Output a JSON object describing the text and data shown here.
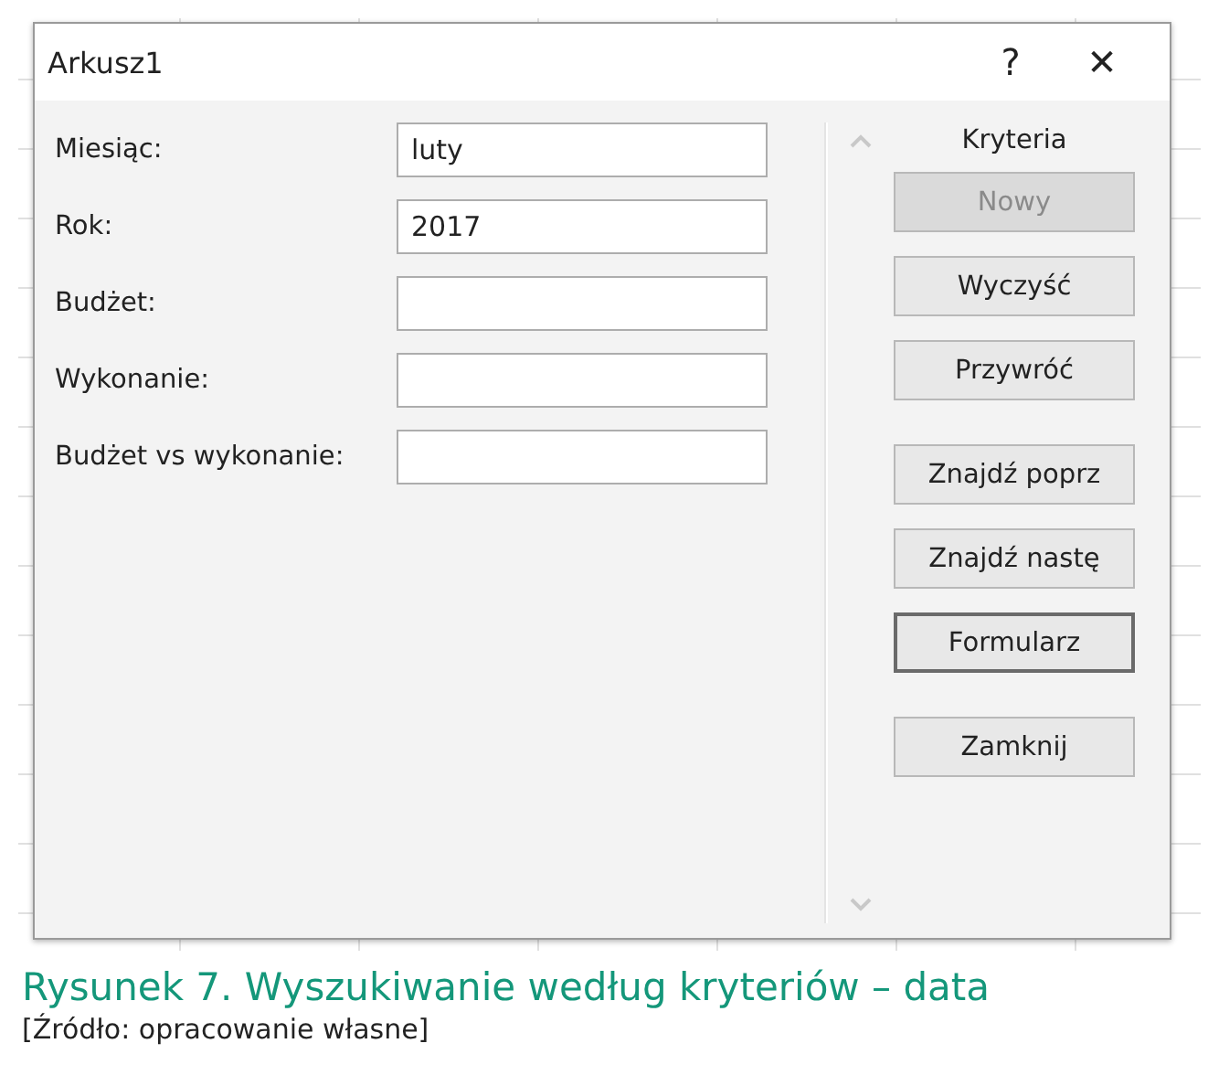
{
  "window": {
    "title": "Arkusz1",
    "help": "?",
    "close": "✕"
  },
  "fields": [
    {
      "label": "Miesiąc:",
      "value": "luty"
    },
    {
      "label": "Rok:",
      "value": "2017"
    },
    {
      "label": "Budżet:"
    },
    {
      "label": "Wykonanie:"
    },
    {
      "label": "Budżet vs wykonanie:"
    }
  ],
  "criteria_label": "Kryteria",
  "button_groups": [
    [
      {
        "label": "Nowy",
        "disabled": true,
        "default": false
      },
      {
        "label": "Wyczyść",
        "disabled": false,
        "default": false
      },
      {
        "label": "Przywróć",
        "disabled": false,
        "default": false
      }
    ],
    [
      {
        "label": "Znajdź poprz",
        "disabled": false,
        "default": false
      },
      {
        "label": "Znajdź nastę",
        "disabled": false,
        "default": false
      },
      {
        "label": "Formularz",
        "disabled": false,
        "default": true
      }
    ],
    [
      {
        "label": "Zamknij",
        "disabled": false,
        "default": false
      }
    ]
  ],
  "caption": {
    "title": "Rysunek 7. Wyszukiwanie według kryteriów – data",
    "source": "[Źródło: opracowanie własne]"
  }
}
